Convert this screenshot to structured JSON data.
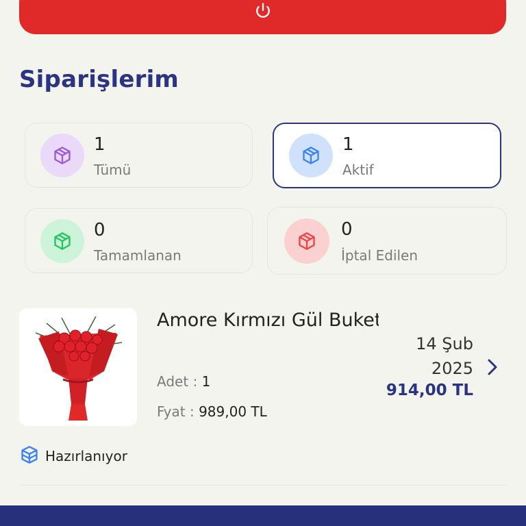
{
  "header": {
    "logout_icon": "power-icon"
  },
  "page": {
    "title": "Siparişlerim"
  },
  "stats": [
    {
      "count": "1",
      "label": "Tümü",
      "color": "#9b59d6",
      "bg": "#ead9f9",
      "icon": "box-icon"
    },
    {
      "count": "1",
      "label": "Aktif",
      "color": "#3b82f6",
      "bg": "#cfe1fb",
      "icon": "box-icon",
      "active": true
    },
    {
      "count": "0",
      "label": "Tamamlanan",
      "color": "#22c55e",
      "bg": "#cdf3d9",
      "icon": "box-icon"
    },
    {
      "count": "0",
      "label": "İptal Edilen",
      "color": "#ef4444",
      "bg": "#fbd0d0",
      "icon": "box-icon"
    }
  ],
  "order": {
    "name": "Amore Kırmızı Gül Buket",
    "qty_label": "Adet :",
    "qty_value": "1",
    "price_label": "Fyat :",
    "price_value": "989,00 TL",
    "date_day": "14 Şub",
    "date_year": "2025",
    "total": "914,00 TL",
    "status": "Hazırlanıyor",
    "status_icon": "boxes-icon"
  },
  "colors": {
    "accent": "#2b3383",
    "danger": "#e02a2a",
    "background": "#f4f4ef"
  }
}
